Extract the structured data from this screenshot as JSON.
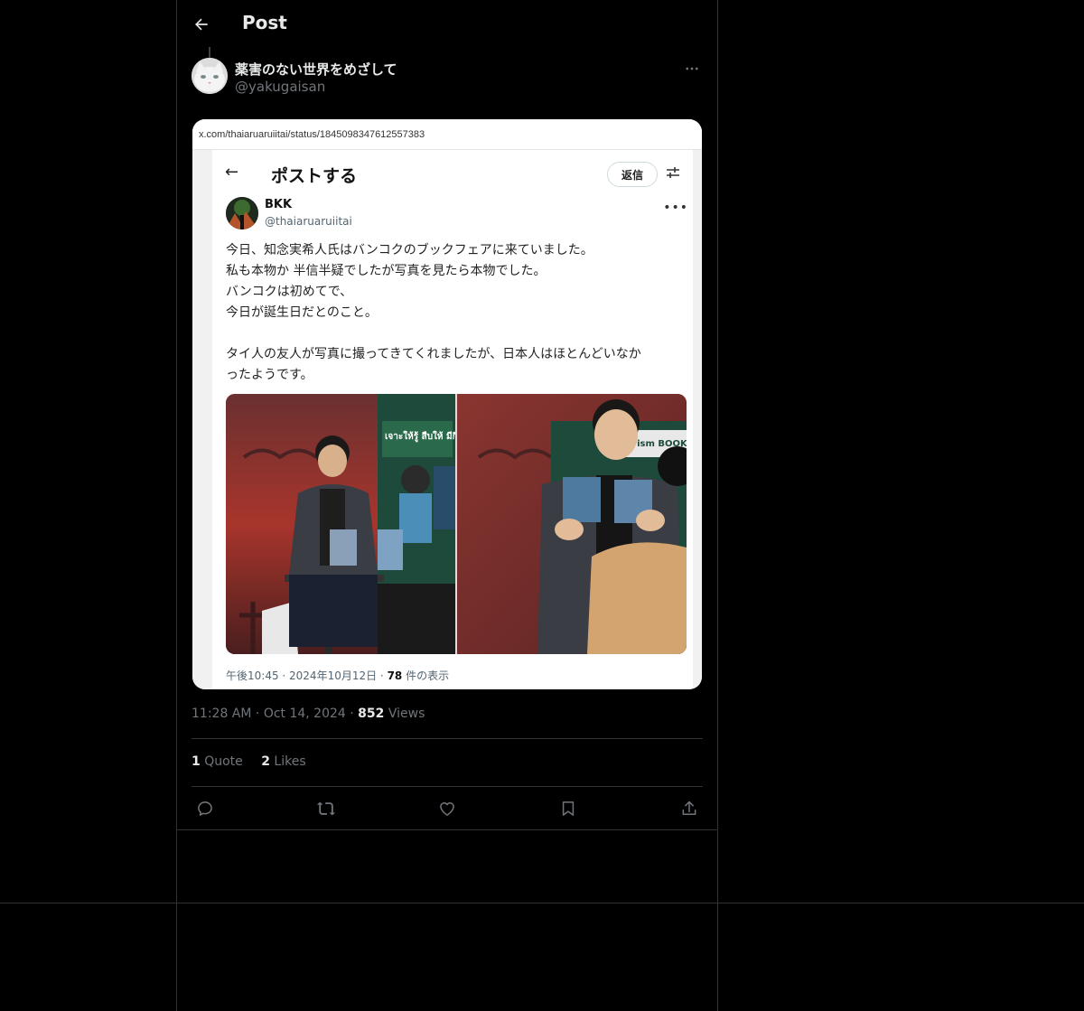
{
  "header": {
    "title": "Post"
  },
  "author": {
    "display_name": "薬害のない世界をめざして",
    "handle": "@yakugaisan"
  },
  "media": {
    "url": "x.com/thaiaruaruiitai/status/1845098347612557383",
    "inner_header": {
      "title": "ポストする",
      "reply_label": "返信"
    },
    "inner_author": {
      "display_name": "BKK",
      "handle": "@thaiaruaruiitai"
    },
    "inner_lines": [
      "今日、知念実希人氏はバンコクのブックフェアに来ていました。",
      "私も本物か 半信半疑でしたが写真を見たら本物でした。",
      "バンコクは初めてで、",
      "今日が誕生日だとのこと。",
      "",
      "タイ人の友人が写真に撮ってきてくれましたが、日本人はほとんどいなか",
      "ったようです。"
    ],
    "inner_meta": {
      "time": "午後10:45 · 2024年10月12日 · ",
      "views_count": "78",
      "views_label": " 件の表示"
    },
    "photo_texts": {
      "banner_left": "เจาะให้รู้ สืบให้ มีกิโตะ",
      "banner_right": "prism BOOK TA"
    }
  },
  "post_meta": {
    "time": "11:28 AM",
    "date": "Oct 14, 2024",
    "views_count": "852",
    "views_label": "Views"
  },
  "stats": {
    "quote_count": "1",
    "quote_label": "Quote",
    "likes_count": "2",
    "likes_label": "Likes"
  },
  "colors": {
    "background": "#000000",
    "border": "#2f3336",
    "text": "#e7e9ea",
    "muted": "#71767b"
  }
}
